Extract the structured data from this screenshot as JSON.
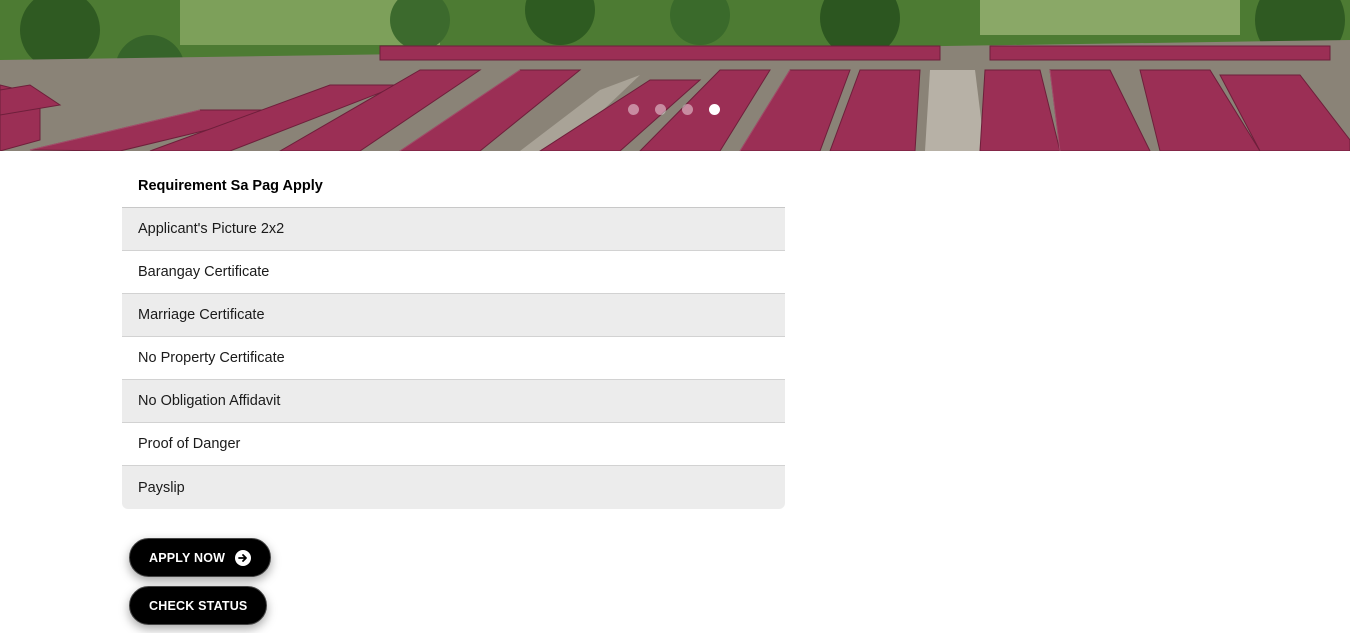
{
  "hero": {
    "carousel": {
      "slide_count": 4,
      "active_slide": 4
    }
  },
  "requirements": {
    "heading": "Requirement Sa Pag Apply",
    "items": [
      "Applicant's Picture 2x2",
      "Barangay Certificate",
      "Marriage Certificate",
      "No Property Certificate",
      "No Obligation Affidavit",
      "Proof of Danger",
      "Payslip"
    ]
  },
  "actions": {
    "apply_label": "APPLY NOW",
    "status_label": "CHECK STATUS",
    "apply_icon": "arrow-right-circle-icon"
  },
  "colors": {
    "button_bg": "#000000",
    "row_alt": "#ececec",
    "roof": "#9b2f55"
  }
}
